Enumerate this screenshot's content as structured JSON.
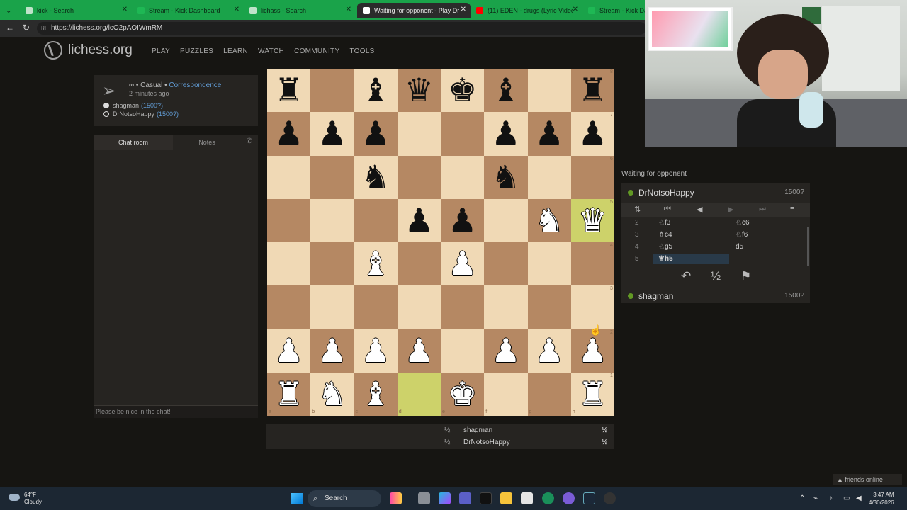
{
  "browser": {
    "tabs": [
      {
        "title": "kick - Search",
        "favicon_color": "#bfe3c9"
      },
      {
        "title": "Stream - Kick Dashboard",
        "favicon_color": "#1eb854"
      },
      {
        "title": "lichass - Search",
        "favicon_color": "#bfe3c9"
      },
      {
        "title": "Waiting for opponent - Play DrNo",
        "favicon_color": "#ffffff"
      },
      {
        "title": "(11) EDEN - drugs (Lyric Video",
        "favicon_color": "#ff0000"
      },
      {
        "title": "Stream - Kick Dash",
        "favicon_color": "#1eb854"
      }
    ],
    "url": "https://lichess.org/lcO2pAOIWmRM"
  },
  "site": {
    "title": "lichess.org",
    "nav": [
      "PLAY",
      "PUZZLES",
      "LEARN",
      "WATCH",
      "COMMUNITY",
      "TOOLS"
    ]
  },
  "game_info": {
    "mode_prefix": "∞ • Casual •",
    "mode_link": "Correspondence",
    "time_ago": "2 minutes ago",
    "white_player": "shagman",
    "white_rating": "(1500?)",
    "black_player": "DrNotsoHappy",
    "black_rating": "(1500?)"
  },
  "chat": {
    "tab_chat": "Chat room",
    "tab_notes": "Notes",
    "input_placeholder": "Please be nice in the chat!"
  },
  "board": {
    "pieces": [
      {
        "sq": "a8",
        "g": "♜",
        "c": "b"
      },
      {
        "sq": "c8",
        "g": "♝",
        "c": "b"
      },
      {
        "sq": "d8",
        "g": "♛",
        "c": "b"
      },
      {
        "sq": "e8",
        "g": "♚",
        "c": "b"
      },
      {
        "sq": "f8",
        "g": "♝",
        "c": "b"
      },
      {
        "sq": "h8",
        "g": "♜",
        "c": "b"
      },
      {
        "sq": "a7",
        "g": "♟",
        "c": "b"
      },
      {
        "sq": "b7",
        "g": "♟",
        "c": "b"
      },
      {
        "sq": "c7",
        "g": "♟",
        "c": "b"
      },
      {
        "sq": "f7",
        "g": "♟",
        "c": "b"
      },
      {
        "sq": "g7",
        "g": "♟",
        "c": "b"
      },
      {
        "sq": "h7",
        "g": "♟",
        "c": "b"
      },
      {
        "sq": "c6",
        "g": "♞",
        "c": "b"
      },
      {
        "sq": "f6",
        "g": "♞",
        "c": "b"
      },
      {
        "sq": "d5",
        "g": "♟",
        "c": "b"
      },
      {
        "sq": "e5",
        "g": "♟",
        "c": "b"
      },
      {
        "sq": "g5",
        "g": "♞",
        "c": "w"
      },
      {
        "sq": "h5",
        "g": "♛",
        "c": "w"
      },
      {
        "sq": "c4",
        "g": "♝",
        "c": "w"
      },
      {
        "sq": "e4",
        "g": "♟",
        "c": "w"
      },
      {
        "sq": "a2",
        "g": "♟",
        "c": "w"
      },
      {
        "sq": "b2",
        "g": "♟",
        "c": "w"
      },
      {
        "sq": "c2",
        "g": "♟",
        "c": "w"
      },
      {
        "sq": "d2",
        "g": "♟",
        "c": "w"
      },
      {
        "sq": "f2",
        "g": "♟",
        "c": "w"
      },
      {
        "sq": "g2",
        "g": "♟",
        "c": "w"
      },
      {
        "sq": "h2",
        "g": "♟",
        "c": "w"
      },
      {
        "sq": "a1",
        "g": "♜",
        "c": "w"
      },
      {
        "sq": "b1",
        "g": "♞",
        "c": "w"
      },
      {
        "sq": "c1",
        "g": "♝",
        "c": "w"
      },
      {
        "sq": "e1",
        "g": "♚",
        "c": "w"
      },
      {
        "sq": "h1",
        "g": "♜",
        "c": "w"
      }
    ],
    "last_move": [
      "d1",
      "h5"
    ],
    "rank_labels": [
      "8",
      "7",
      "6",
      "5",
      "4",
      "3",
      "2",
      "1"
    ],
    "file_labels": [
      "a",
      "b",
      "c",
      "d",
      "e",
      "f",
      "g",
      "h"
    ]
  },
  "scores": [
    {
      "left": "½",
      "name": "shagman",
      "right": "½"
    },
    {
      "left": "½",
      "name": "DrNotsoHappy",
      "right": "½"
    }
  ],
  "right_panel": {
    "status": "Waiting for opponent",
    "top_player": {
      "name": "DrNotsoHappy",
      "rating": "1500?"
    },
    "bottom_player": {
      "name": "shagman",
      "rating": "1500?"
    },
    "moves": [
      {
        "num": "2",
        "white": "♘f3",
        "black": "♘c6"
      },
      {
        "num": "3",
        "white": "♗c4",
        "black": "♘f6"
      },
      {
        "num": "4",
        "white": "♘g5",
        "black": "d5"
      },
      {
        "num": "5",
        "white": "♕h5",
        "black": ""
      }
    ],
    "draw_symbol": "½"
  },
  "friends": "▲ friends online",
  "taskbar": {
    "temp": "64°F",
    "condition": "Cloudy",
    "search": "Search",
    "time": "3:47 AM",
    "date": "4/30/2026"
  },
  "colors": {
    "light_square": "#f0d9b5",
    "dark_square": "#b58863",
    "last_move": "#cdd26a",
    "online_dot": "#629924",
    "link": "#629cd5"
  }
}
